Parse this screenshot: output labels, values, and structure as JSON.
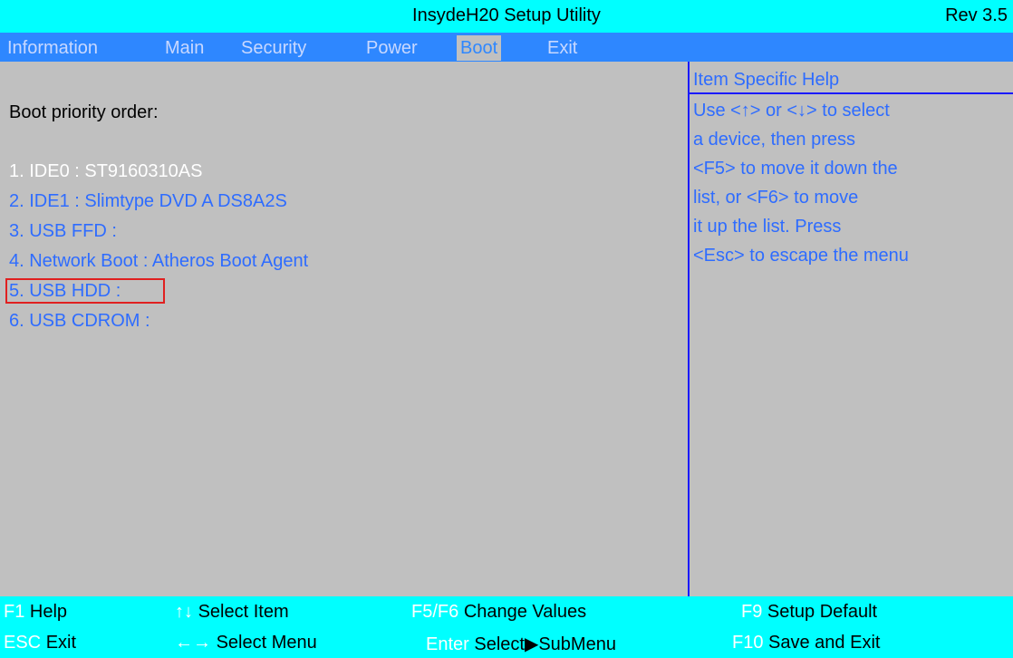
{
  "titlebar": {
    "title": "InsydeH20 Setup Utility",
    "rev": "Rev 3.5"
  },
  "menu": {
    "tabs": [
      {
        "label": "Information"
      },
      {
        "label": "Main"
      },
      {
        "label": "Security"
      },
      {
        "label": "Power"
      },
      {
        "label": "Boot",
        "active": true
      },
      {
        "label": "Exit"
      }
    ]
  },
  "main": {
    "section_label": "Boot priority order:",
    "boot_items": [
      {
        "label": "1. IDE0 : ST9160310AS",
        "selected": true
      },
      {
        "label": "2. IDE1 : Slimtype DVD A DS8A2S"
      },
      {
        "label": "3. USB FFD :"
      },
      {
        "label": "4. Network Boot : Atheros Boot Agent"
      },
      {
        "label": "5. USB HDD :",
        "highlighted": true
      },
      {
        "label": "6. USB CDROM :"
      }
    ]
  },
  "help": {
    "title": "Item Specific Help",
    "lines": [
      "Use <↑> or <↓> to select",
      "a device, then press",
      "<F5> to move it down the",
      "list, or <F6> to move",
      "it up the list. Press",
      "<Esc> to escape the menu"
    ]
  },
  "footer": {
    "f1_key": "F1",
    "f1_label": "Help",
    "esc_key": "ESC",
    "esc_label": "Exit",
    "updown_key": "↑↓",
    "updown_label": "Select Item",
    "leftright_key": "←→",
    "leftright_label": "Select Menu",
    "f5f6_key": "F5/F6",
    "f5f6_label": "Change Values",
    "enter_key": "Enter",
    "enter_label": "Select▶SubMenu",
    "f9_key": "F9",
    "f9_label": "Setup Default",
    "f10_key": "F10",
    "f10_label": "Save and Exit"
  },
  "colors": {
    "background": "#c0c0c0",
    "titlebar": "#00ffff",
    "menubar": "#2e87ff",
    "item_text": "#2e6cff",
    "selected_text": "#ffffff",
    "highlight_border": "#e02020"
  }
}
